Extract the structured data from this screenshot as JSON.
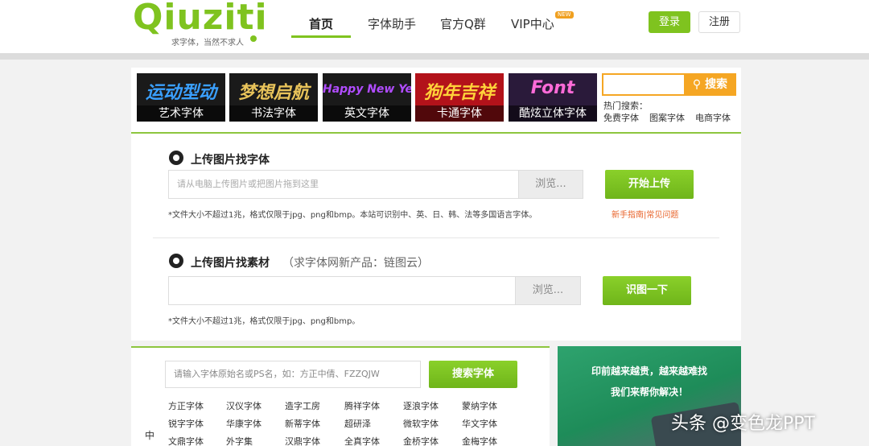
{
  "header": {
    "logo_word": "Qiuziti",
    "logo_tagline": "求字体，当然不求人",
    "nav": [
      {
        "label": "首页",
        "active": true
      },
      {
        "label": "字体助手"
      },
      {
        "label": "官方Q群"
      },
      {
        "label": "VIP中心",
        "badge": "NEW"
      }
    ],
    "login_label": "登录",
    "register_label": "注册"
  },
  "categories": [
    {
      "art_text": "运动型动",
      "art_color": "#3aa0ff",
      "label": "艺术字体"
    },
    {
      "art_text": "梦想启航",
      "art_color": "#e8c35a",
      "label": "书法字体"
    },
    {
      "art_text": "Happy New Year",
      "art_color": "#b04cff",
      "label": "英文字体"
    },
    {
      "art_text": "狗年吉祥",
      "art_color": "#ffd23a",
      "label": "卡通字体"
    },
    {
      "art_text": "Font",
      "art_color": "#ff6bd8",
      "label": "酷炫立体字体"
    }
  ],
  "search": {
    "placeholder": "",
    "button_label": "搜索",
    "hot_label": "热门搜索：",
    "hot_links": [
      "免费字体",
      "图案字体",
      "电商字体"
    ]
  },
  "upload_font": {
    "title": "上传图片找字体",
    "placeholder": "请从电脑上传图片或把图片拖到这里",
    "browse_label": "浏览...",
    "button_label": "开始上传",
    "note": "*文件大小不超过1兆，格式仅限于jpg、png和bmp。本站可识别中、英、日、韩、法等多国语言字体。",
    "help_links": "新手指南|常见问题"
  },
  "upload_material": {
    "title": "上传图片找素材",
    "subtitle": "（求字体网新产品：链图云）",
    "browse_label": "浏览...",
    "button_label": "识图一下",
    "note": "*文件大小不超过1兆，格式仅限于jpg、png和bmp。"
  },
  "name_search": {
    "placeholder": "请输入字体原始名或PS名，如：方正中倩、FZZQJW",
    "button_label": "搜索字体",
    "side_char": "中",
    "font_links": [
      [
        "方正字体",
        "汉仪字体",
        "造字工房",
        "腾祥字体",
        "逐浪字体",
        "蒙纳字体"
      ],
      [
        "锐字字体",
        "华康字体",
        "新蒂字体",
        "超研泽",
        "微软字体",
        "华文字体"
      ],
      [
        "文鼎字体",
        "外字集",
        "汉鼎字体",
        "全真字体",
        "金桥字体",
        "金梅字体"
      ]
    ]
  },
  "promo": {
    "line1": "印前越来越贵，越来越难找",
    "line2": "我们来帮你解决！"
  },
  "watermark": "头条 @变色龙PPT"
}
